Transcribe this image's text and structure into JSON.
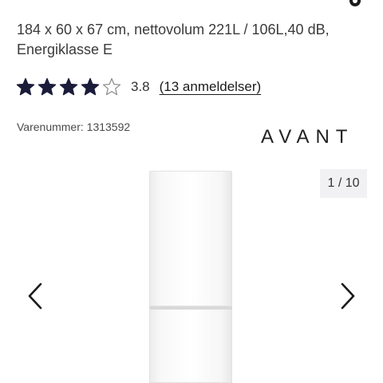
{
  "product": {
    "subtitle": "184 x 60 x 67 cm, nettovolum 221L / 106L,40 dB, Energiklasse E",
    "brand": "AVANT",
    "sku_label": "Varenummer: 1313592"
  },
  "rating": {
    "value": 3.8,
    "value_text": "3.8",
    "max": 5,
    "reviews_link": "(13 anmeldelser)",
    "star_color": "#1b1b3a"
  },
  "gallery": {
    "counter": "1 / 10",
    "prev_icon": "chevron-left-icon",
    "next_icon": "chevron-right-icon"
  }
}
